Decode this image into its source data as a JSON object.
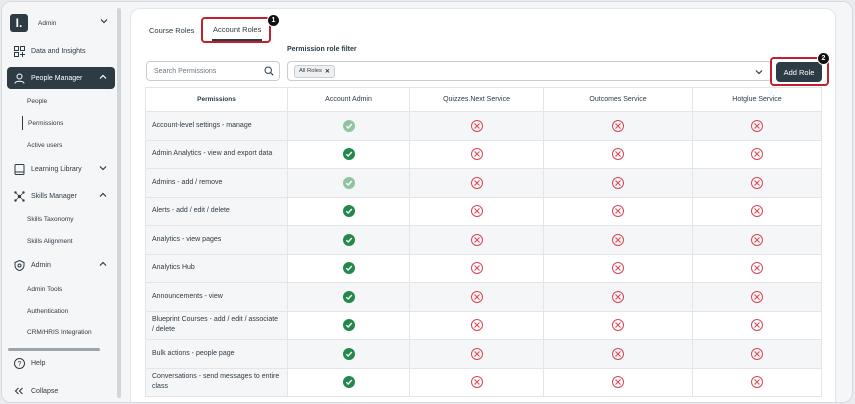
{
  "sidebar": {
    "brand_letter": "I.",
    "brand_name": "Admin",
    "items": [
      {
        "label": "Data and Insights"
      },
      {
        "label": "People Manager"
      },
      {
        "label": "Learning Library"
      },
      {
        "label": "Skills Manager"
      },
      {
        "label": "Admin"
      }
    ],
    "people_sub": [
      "People",
      "Permissions",
      "Active users"
    ],
    "skills_sub": [
      "Skills Taxonomy",
      "Skills Alignment"
    ],
    "admin_sub": [
      "Admin Tools",
      "Authentication",
      "CRM/HRIS Integration"
    ],
    "help": "Help",
    "collapse": "Collapse"
  },
  "tabs": {
    "course_roles": "Course Roles",
    "account_roles": "Account Roles"
  },
  "callouts": {
    "one": "1",
    "two": "2"
  },
  "filter": {
    "label": "Permission role filter",
    "search_placeholder": "Search Permissions",
    "chip": "All Roles"
  },
  "add_role": "Add Role",
  "table": {
    "permissions_header": "Permissions",
    "columns": [
      "Account Admin",
      "Quizzes.Next Service",
      "Outcomes Service",
      "Hotglue Service"
    ],
    "rows": [
      {
        "label": "Account-level settings - manage",
        "values": [
          "enabled-light",
          "denied",
          "denied",
          "denied"
        ]
      },
      {
        "label": "Admin Analytics - view and export data",
        "values": [
          "enabled",
          "denied",
          "denied",
          "denied"
        ]
      },
      {
        "label": "Admins - add / remove",
        "values": [
          "enabled-light",
          "denied",
          "denied",
          "denied"
        ]
      },
      {
        "label": "Alerts - add / edit / delete",
        "values": [
          "enabled",
          "denied",
          "denied",
          "denied"
        ]
      },
      {
        "label": "Analytics - view pages",
        "values": [
          "enabled",
          "denied",
          "denied",
          "denied"
        ]
      },
      {
        "label": "Analytics Hub",
        "values": [
          "enabled",
          "denied",
          "denied",
          "denied"
        ]
      },
      {
        "label": "Announcements - view",
        "values": [
          "enabled",
          "denied",
          "denied",
          "denied"
        ]
      },
      {
        "label": "Blueprint Courses - add / edit / associate / delete",
        "values": [
          "enabled",
          "denied",
          "denied",
          "denied"
        ]
      },
      {
        "label": "Bulk actions - people page",
        "values": [
          "enabled",
          "denied",
          "denied",
          "denied"
        ]
      },
      {
        "label": "Conversations - send messages to entire class",
        "values": [
          "enabled",
          "denied",
          "denied",
          "denied"
        ]
      }
    ]
  }
}
